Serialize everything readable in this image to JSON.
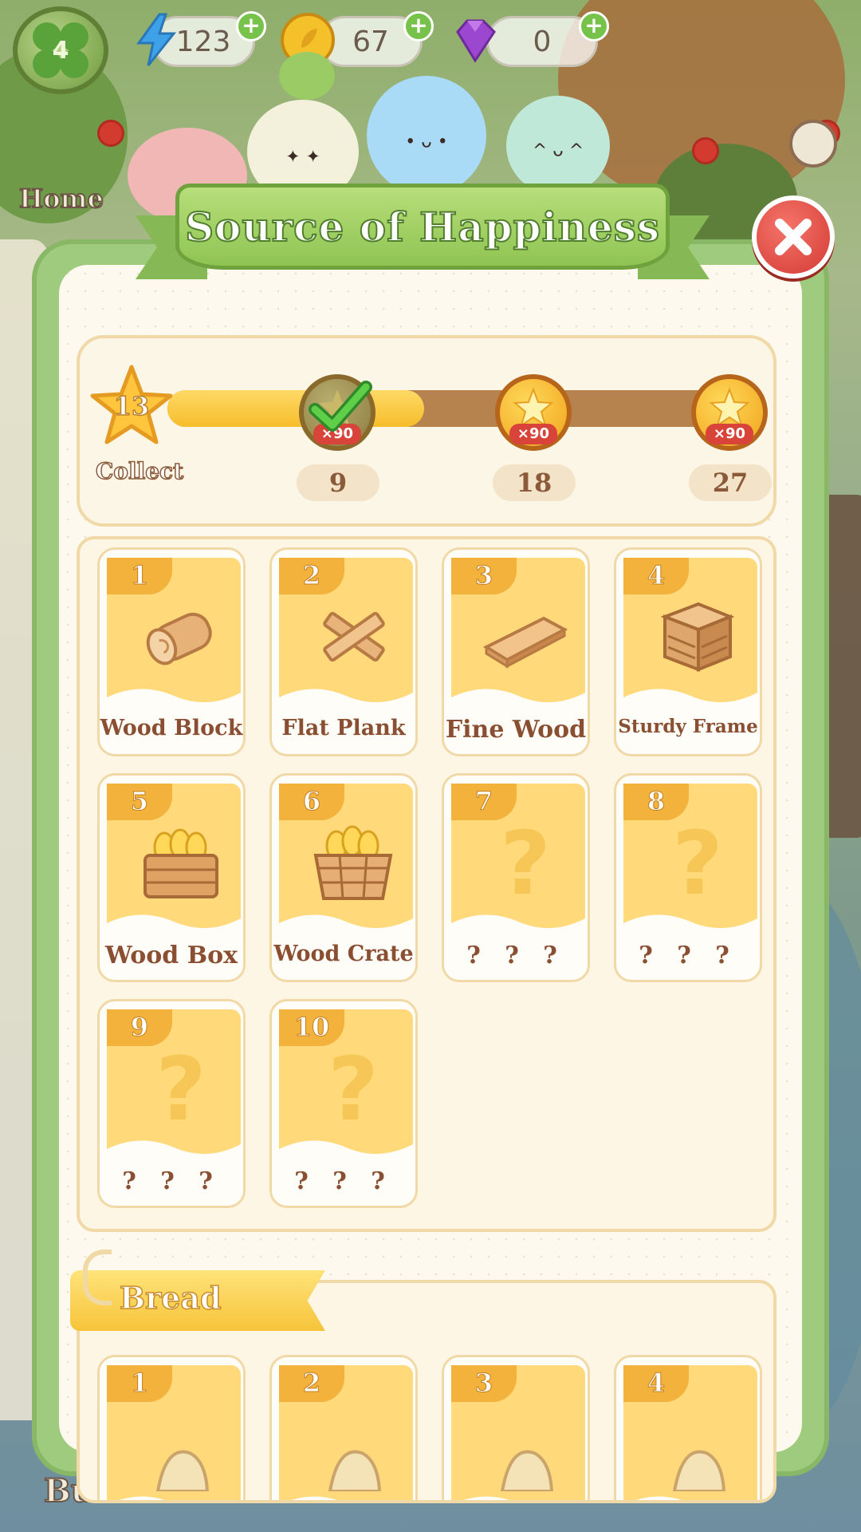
{
  "hud": {
    "level": "4",
    "energy": "123",
    "coins": "67",
    "gems": "0",
    "home_label": "Home",
    "build_label": "Build"
  },
  "modal": {
    "title": "Source of Happiness",
    "collect_count": "13",
    "collect_label": "Collect",
    "progress_fraction": 0.46,
    "milestones": [
      {
        "threshold": "9",
        "reward": "×90",
        "claimed": true
      },
      {
        "threshold": "18",
        "reward": "×90",
        "claimed": false
      },
      {
        "threshold": "27",
        "reward": "×90",
        "claimed": false
      }
    ]
  },
  "wood_items": [
    {
      "num": "1",
      "name": "Wood Block",
      "icon": "log-icon"
    },
    {
      "num": "2",
      "name": "Flat Plank",
      "icon": "crossed-planks-icon"
    },
    {
      "num": "3",
      "name": "Fine Wood",
      "icon": "board-icon"
    },
    {
      "num": "4",
      "name": "Sturdy Frame",
      "icon": "frame-icon"
    },
    {
      "num": "5",
      "name": "Wood Box",
      "icon": "wood-box-icon"
    },
    {
      "num": "6",
      "name": "Wood Crate",
      "icon": "wood-crate-icon"
    },
    {
      "num": "7",
      "name": "? ? ?",
      "icon": "question-icon"
    },
    {
      "num": "8",
      "name": "? ? ?",
      "icon": "question-icon"
    },
    {
      "num": "9",
      "name": "? ? ?",
      "icon": "question-icon"
    },
    {
      "num": "10",
      "name": "? ? ?",
      "icon": "question-icon"
    }
  ],
  "bread_section": {
    "label": "Bread",
    "items": [
      {
        "num": "1"
      },
      {
        "num": "2"
      },
      {
        "num": "3"
      },
      {
        "num": "4"
      }
    ]
  },
  "colors": {
    "modal_green": "#9fcb7f",
    "card_yellow": "#ffd97a",
    "accent_orange": "#f2b23c",
    "close_red": "#d43b33"
  }
}
